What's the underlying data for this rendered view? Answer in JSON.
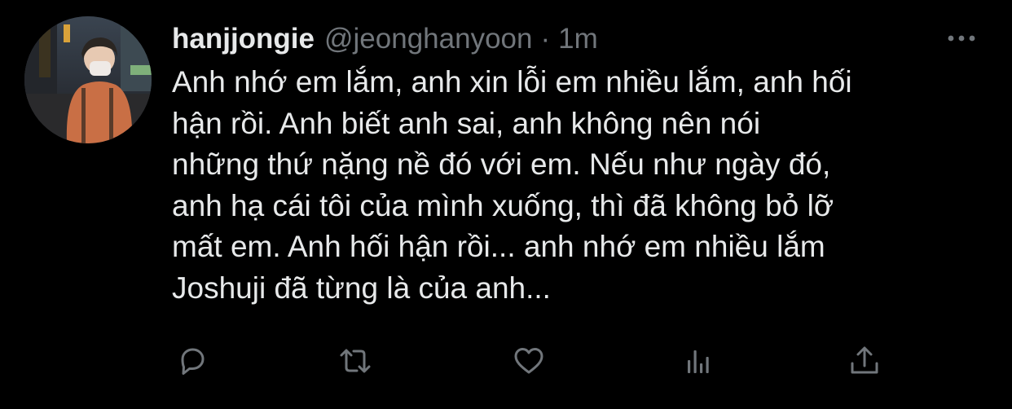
{
  "tweet": {
    "display_name": "hanjjongie",
    "handle": "@jeonghanyoon",
    "separator": "·",
    "time": "1m",
    "text": "Anh nhớ em lắm, anh xin lỗi em nhiều lắm, anh hối\nhận rồi. Anh biết anh sai, anh không nên nói\nnhững thứ nặng nề đó với em. Nếu như ngày đó,\nanh hạ cái tôi của mình xuống, thì đã không bỏ lỡ\nmất em. Anh hối hận rồi... anh nhớ em nhiều lắm\nJoshuji đã từng là của anh..."
  },
  "actions": {
    "reply_icon": "reply-icon",
    "retweet_icon": "retweet-icon",
    "like_icon": "heart-icon",
    "analytics_icon": "analytics-icon",
    "share_icon": "share-icon",
    "more_icon": "more-horizontal-icon"
  },
  "colors": {
    "background": "#000000",
    "primary_text": "#e7e9ea",
    "secondary_text": "#71767b"
  }
}
